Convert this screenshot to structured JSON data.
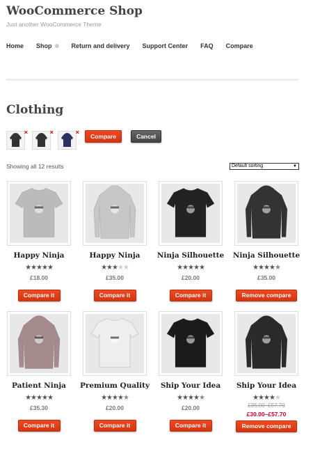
{
  "header": {
    "site_title": "WooCommerce Shop",
    "tagline": "Just another WooCommerce Theme"
  },
  "nav": [
    {
      "label": "Home"
    },
    {
      "label": "Shop"
    },
    {
      "label": "Return and delivery"
    },
    {
      "label": "Support Center"
    },
    {
      "label": "FAQ"
    },
    {
      "label": "Compare"
    }
  ],
  "page_title": "Clothing",
  "compare_bar": {
    "compare_label": "Compare",
    "cancel_label": "Cancel",
    "remove_icon": "×"
  },
  "results_text": "Showing all 12 results",
  "sort": {
    "selected": "Default sorting",
    "arrow": "▼"
  },
  "products": [
    {
      "name": "Happy Ninja",
      "rating": 5,
      "price": "£18.00",
      "button": "Compare it",
      "kind": "tshirt",
      "color": "#bbb"
    },
    {
      "name": "Happy Ninja",
      "rating": 3,
      "price": "£35.00",
      "button": "Compare it",
      "kind": "hoodie",
      "color": "#c7c7c7"
    },
    {
      "name": "Ninja Silhouette",
      "rating": 5,
      "price": "£20.00",
      "button": "Compare it",
      "kind": "tshirt",
      "color": "#222"
    },
    {
      "name": "Ninja Silhouette",
      "rating": 4.5,
      "price": "£35.00",
      "button": "Remove compare",
      "kind": "hoodie",
      "color": "#333"
    },
    {
      "name": "Patient Ninja",
      "rating": 5,
      "price": "£35.30",
      "button": "Compare it",
      "kind": "hoodie",
      "color": "#a48c8c"
    },
    {
      "name": "Premium Quality",
      "rating": 4.5,
      "price": "£20.00",
      "button": "Compare it",
      "kind": "tshirt",
      "color": "#eee"
    },
    {
      "name": "Ship Your Idea",
      "rating": 4.5,
      "price": "£20.00",
      "button": "Compare it",
      "kind": "tshirt",
      "color": "#1b1b1b"
    },
    {
      "name": "Ship Your Idea",
      "rating": 4,
      "price_old": "£35.00–£57.70",
      "price_new": "£30.00–£57.70",
      "button": "Remove compare",
      "kind": "hoodie",
      "color": "#2a2a2a"
    }
  ],
  "compare_items": [
    {
      "color": "#333"
    },
    {
      "color": "#333"
    },
    {
      "color": "#2a3060"
    }
  ],
  "colors": {
    "accent": "#e0401a",
    "cancel": "#555555"
  },
  "icons": {
    "star": "★"
  }
}
